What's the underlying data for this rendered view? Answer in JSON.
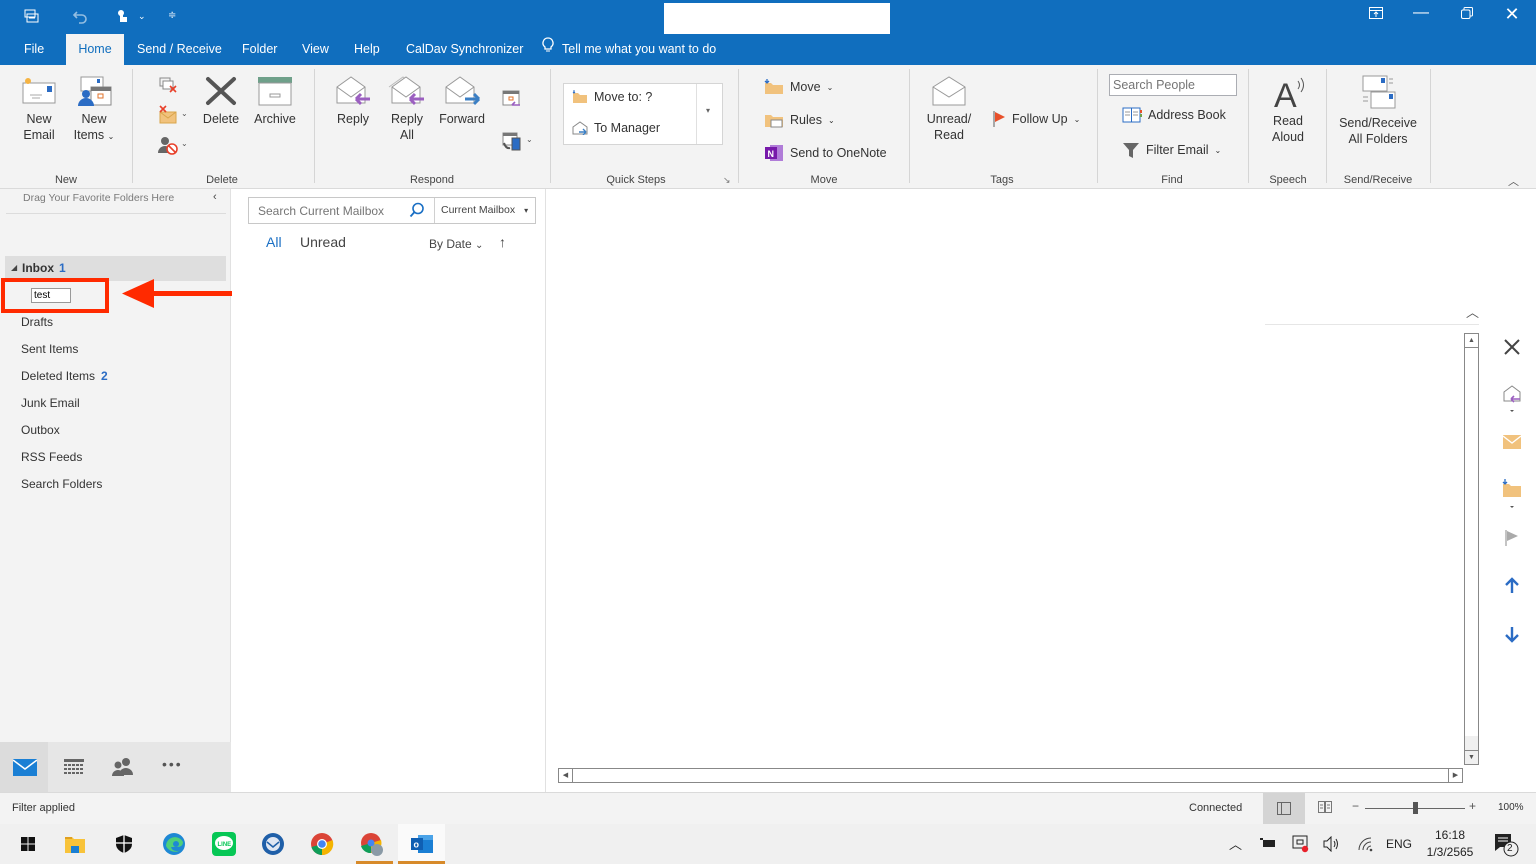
{
  "titlebar": {
    "title": "",
    "quick_access": [
      "outlook-icon",
      "undo-icon",
      "touch-mode-icon",
      "customize-qat-icon"
    ],
    "window_controls": [
      "ribbon-display-options",
      "minimize",
      "restore",
      "close"
    ]
  },
  "tabs": [
    {
      "label": "File"
    },
    {
      "label": "Home",
      "active": true
    },
    {
      "label": "Send / Receive"
    },
    {
      "label": "Folder"
    },
    {
      "label": "View"
    },
    {
      "label": "Help"
    },
    {
      "label": "CalDav Synchronizer"
    }
  ],
  "tell_me": "Tell me what you want to do",
  "ribbon": {
    "new_group": {
      "label": "New",
      "new_email": "New\nEmail",
      "new_email_l1": "New",
      "new_email_l2": "Email",
      "new_items_l1": "New",
      "new_items_l2": "Items"
    },
    "delete_group": {
      "label": "Delete",
      "delete": "Delete",
      "archive": "Archive"
    },
    "respond_group": {
      "label": "Respond",
      "reply": "Reply",
      "reply_all_l1": "Reply",
      "reply_all_l2": "All",
      "forward": "Forward"
    },
    "quick_steps": {
      "label": "Quick Steps",
      "items": [
        "Move to: ?",
        "To Manager"
      ]
    },
    "move_group": {
      "label": "Move",
      "move": "Move",
      "rules": "Rules",
      "onenote": "Send to OneNote"
    },
    "tags_group": {
      "label": "Tags",
      "unread_l1": "Unread/",
      "unread_l2": "Read",
      "follow_up": "Follow Up"
    },
    "find_group": {
      "label": "Find",
      "search_people_placeholder": "Search People",
      "address_book": "Address Book",
      "filter_email": "Filter Email"
    },
    "speech_group": {
      "label": "Speech",
      "read_l1": "Read",
      "read_l2": "Aloud"
    },
    "sendreceive_group": {
      "label": "Send/Receive",
      "sr_l1": "Send/Receive",
      "sr_l2": "All Folders"
    }
  },
  "favorites": {
    "hint": "Drag Your Favorite Folders Here"
  },
  "folders": {
    "inbox": {
      "label": "Inbox",
      "count": "1"
    },
    "rename_value": "test",
    "items": [
      {
        "label": "Drafts",
        "count": ""
      },
      {
        "label": "Sent Items",
        "count": ""
      },
      {
        "label": "Deleted Items",
        "count": "2"
      },
      {
        "label": "Junk Email",
        "count": ""
      },
      {
        "label": "Outbox",
        "count": ""
      },
      {
        "label": "RSS Feeds",
        "count": ""
      },
      {
        "label": "Search Folders",
        "count": ""
      }
    ]
  },
  "annotation": {
    "color": "#ff2a00"
  },
  "list": {
    "search_placeholder": "Search Current Mailbox",
    "scope": "Current Mailbox",
    "filter_all": "All",
    "filter_unread": "Unread",
    "sort": "By Date"
  },
  "status": {
    "left": "Filter applied",
    "connection": "Connected",
    "zoom": "100%",
    "zoom_level": 1.0
  },
  "taskbar": {
    "apps": [
      "windows-start",
      "file-explorer",
      "windows-security",
      "edge",
      "line",
      "thunderbird",
      "chrome",
      "chrome-profile",
      "outlook"
    ],
    "language": "ENG",
    "time": "16:18",
    "date": "1/3/2565",
    "notifications": "2"
  },
  "colors": {
    "accent": "#106ebe",
    "link": "#2b6cc4"
  }
}
